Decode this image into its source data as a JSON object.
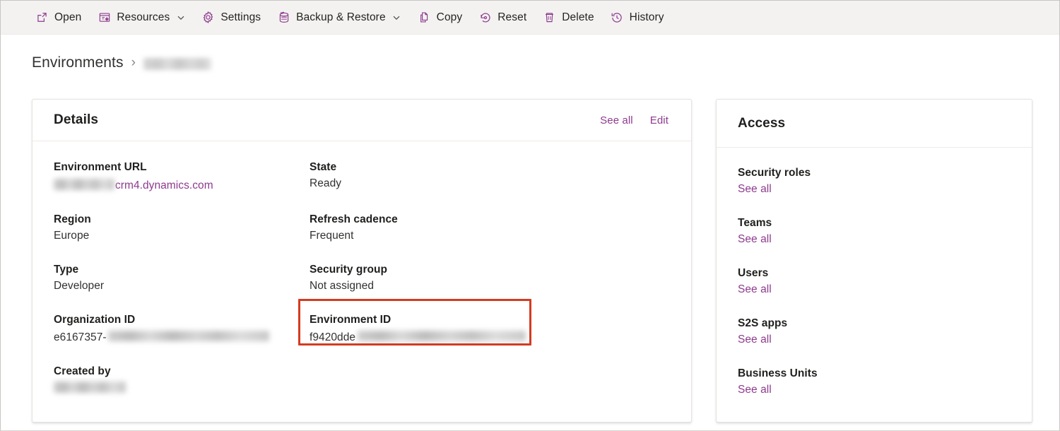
{
  "commandbar": {
    "items": [
      {
        "label": "Open",
        "icon": "open-external-icon",
        "caret": false
      },
      {
        "label": "Resources",
        "icon": "resources-icon",
        "caret": true
      },
      {
        "label": "Settings",
        "icon": "gear-icon",
        "caret": false
      },
      {
        "label": "Backup & Restore",
        "icon": "database-restore-icon",
        "caret": true
      },
      {
        "label": "Copy",
        "icon": "copy-icon",
        "caret": false
      },
      {
        "label": "Reset",
        "icon": "reset-icon",
        "caret": false
      },
      {
        "label": "Delete",
        "icon": "trash-icon",
        "caret": false
      },
      {
        "label": "History",
        "icon": "history-clock-icon",
        "caret": false
      }
    ]
  },
  "breadcrumb": {
    "root": "Environments",
    "separator": "›",
    "current_redacted": true
  },
  "details": {
    "title": "Details",
    "see_all_label": "See all",
    "edit_label": "Edit",
    "fields": [
      {
        "label": "Environment URL",
        "value": "crm4.dynamics.com",
        "redacted_prefix": true,
        "is_link": true
      },
      {
        "label": "State",
        "value": "Ready",
        "redacted_prefix": false,
        "is_link": false
      },
      {
        "label": "Region",
        "value": "Europe",
        "redacted_prefix": false,
        "is_link": false
      },
      {
        "label": "Refresh cadence",
        "value": "Frequent",
        "redacted_prefix": false,
        "is_link": false
      },
      {
        "label": "Type",
        "value": "Developer",
        "redacted_prefix": false,
        "is_link": false
      },
      {
        "label": "Security group",
        "value": "Not assigned",
        "redacted_prefix": false,
        "is_link": false
      },
      {
        "label": "Organization ID",
        "value": "e6167357-",
        "redacted_suffix": true,
        "is_link": false
      },
      {
        "label": "Environment ID",
        "value": "f9420dde",
        "redacted_suffix": true,
        "is_link": false
      },
      {
        "label": "Created by",
        "value": "",
        "redacted_value": true,
        "is_link": false
      }
    ]
  },
  "access": {
    "title": "Access",
    "items": [
      {
        "label": "Security roles",
        "link": "See all"
      },
      {
        "label": "Teams",
        "link": "See all"
      },
      {
        "label": "Users",
        "link": "See all"
      },
      {
        "label": "S2S apps",
        "link": "See all"
      },
      {
        "label": "Business Units",
        "link": "See all"
      }
    ]
  },
  "annotation": {
    "highlight_target": "Environment ID",
    "highlight_color": "#d43b21"
  },
  "colors": {
    "accent": "#8e3a8e",
    "commandbar_bg": "#f3f2f1",
    "text": "#201f1e",
    "highlight": "#d43b21"
  }
}
